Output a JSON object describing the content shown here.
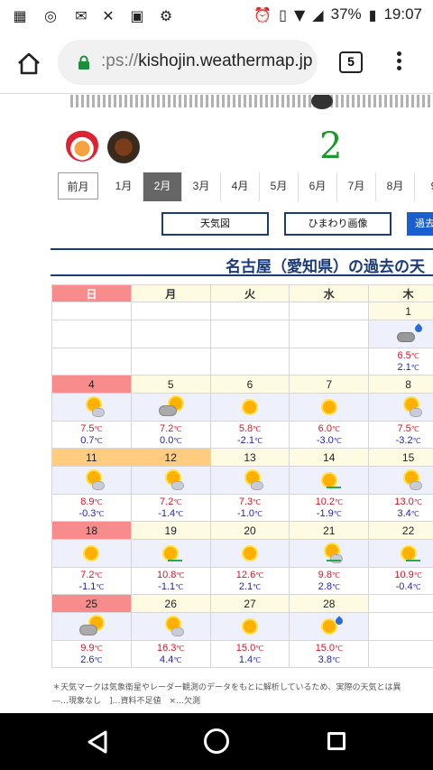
{
  "status": {
    "battery": "37%",
    "time": "19:07",
    "icons": [
      "m-app-icon",
      "instagram-icon",
      "mail-icon",
      "x-icon",
      "image-icon",
      "settings-icon",
      "alarm-icon",
      "vibrate-icon",
      "wifi-icon",
      "signal-icon",
      "battery-icon"
    ]
  },
  "browser": {
    "url_scheme": ":ps://",
    "url_host": "kishojin.weathermap.jp",
    "tab_count": "5"
  },
  "header": {
    "big_number": "2",
    "month_tabs": [
      "前月",
      "1月",
      "2月",
      "3月",
      "4月",
      "5月",
      "6月",
      "7月",
      "8月",
      "9"
    ],
    "active_month": "2月",
    "buttons": {
      "tenkizu": "天気図",
      "himawari": "ひまわり画像",
      "kako": "過去"
    },
    "title": "名古屋（愛知県）の過去の天"
  },
  "calendar": {
    "weekdays": [
      "日",
      "月",
      "火",
      "水",
      "木"
    ],
    "unit": "℃",
    "weeks": [
      {
        "dates": [
          "",
          "",
          "",
          "",
          "1"
        ],
        "hol": [
          0,
          0,
          0,
          0,
          0
        ],
        "weather": [
          "",
          "",
          "",
          "",
          "rain"
        ],
        "hi": [
          "",
          "",
          "",
          "",
          "6.5"
        ],
        "lo": [
          "",
          "",
          "",
          "",
          "2.1"
        ]
      },
      {
        "dates": [
          "4",
          "5",
          "6",
          "7",
          "8"
        ],
        "hol": [
          0,
          0,
          0,
          0,
          0
        ],
        "weather": [
          "sc",
          "cs",
          "sunny",
          "sunny",
          "sc"
        ],
        "hi": [
          "7.5",
          "7.2",
          "5.8",
          "6.0",
          "7.5"
        ],
        "lo": [
          "0.7",
          "0.0",
          "-2.1",
          "-3.0",
          "-3.2"
        ]
      },
      {
        "dates": [
          "11",
          "12",
          "13",
          "14",
          "15"
        ],
        "hol": [
          1,
          1,
          0,
          0,
          0
        ],
        "weather": [
          "sc",
          "sc",
          "sc",
          "sunny-line",
          "sc"
        ],
        "hi": [
          "8.9",
          "7.2",
          "7.3",
          "10.2",
          "13.0"
        ],
        "lo": [
          "-0.3",
          "-1.4",
          "-1.0",
          "-1.9",
          "3.4"
        ]
      },
      {
        "dates": [
          "18",
          "19",
          "20",
          "21",
          "22"
        ],
        "hol": [
          0,
          0,
          0,
          0,
          0
        ],
        "weather": [
          "sunny",
          "sunny-line",
          "sunny",
          "sc-line",
          "sunny-line"
        ],
        "hi": [
          "7.2",
          "10.8",
          "12.6",
          "9.8",
          "10.9"
        ],
        "lo": [
          "-1.1",
          "-1.1",
          "2.1",
          "2.8",
          "-0.4"
        ]
      },
      {
        "dates": [
          "25",
          "26",
          "27",
          "28",
          ""
        ],
        "hol": [
          0,
          0,
          0,
          0,
          0
        ],
        "weather": [
          "cs",
          "sc",
          "sunny",
          "sunny-rain",
          ""
        ],
        "hi": [
          "9.9",
          "16.3",
          "15.0",
          "15.0",
          ""
        ],
        "lo": [
          "2.6",
          "4.4",
          "1.4",
          "3.8",
          ""
        ]
      }
    ]
  },
  "note": {
    "line1": "＊天気マークは気象衛星やレーダー観測のデータをもとに解析しているため、実際の天気とは異",
    "line2": "―…現象なし　]…資料不足値　×…欠測"
  },
  "colors": {
    "sunday": "#f88b8b",
    "holiday": "#ffcc80",
    "hi_temp": "#dd1122",
    "lo_temp": "#2222bb",
    "title_blue": "#1a3a7a",
    "link_blue": "#1a5fd0",
    "big_number_green": "#1a9a2a"
  }
}
